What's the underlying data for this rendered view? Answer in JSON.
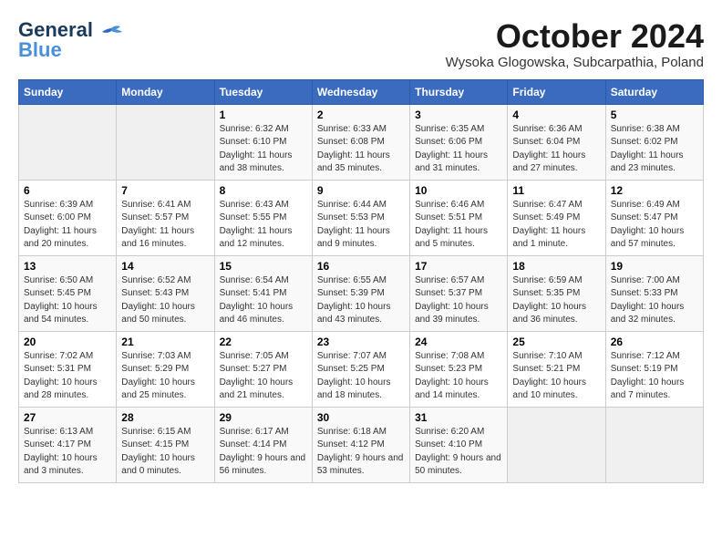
{
  "header": {
    "logo_line1": "General",
    "logo_line2": "Blue",
    "month": "October 2024",
    "location": "Wysoka Glogowska, Subcarpathia, Poland"
  },
  "days_of_week": [
    "Sunday",
    "Monday",
    "Tuesday",
    "Wednesday",
    "Thursday",
    "Friday",
    "Saturday"
  ],
  "weeks": [
    [
      {
        "day": "",
        "sunrise": "",
        "sunset": "",
        "daylight": ""
      },
      {
        "day": "",
        "sunrise": "",
        "sunset": "",
        "daylight": ""
      },
      {
        "day": "1",
        "sunrise": "Sunrise: 6:32 AM",
        "sunset": "Sunset: 6:10 PM",
        "daylight": "Daylight: 11 hours and 38 minutes."
      },
      {
        "day": "2",
        "sunrise": "Sunrise: 6:33 AM",
        "sunset": "Sunset: 6:08 PM",
        "daylight": "Daylight: 11 hours and 35 minutes."
      },
      {
        "day": "3",
        "sunrise": "Sunrise: 6:35 AM",
        "sunset": "Sunset: 6:06 PM",
        "daylight": "Daylight: 11 hours and 31 minutes."
      },
      {
        "day": "4",
        "sunrise": "Sunrise: 6:36 AM",
        "sunset": "Sunset: 6:04 PM",
        "daylight": "Daylight: 11 hours and 27 minutes."
      },
      {
        "day": "5",
        "sunrise": "Sunrise: 6:38 AM",
        "sunset": "Sunset: 6:02 PM",
        "daylight": "Daylight: 11 hours and 23 minutes."
      }
    ],
    [
      {
        "day": "6",
        "sunrise": "Sunrise: 6:39 AM",
        "sunset": "Sunset: 6:00 PM",
        "daylight": "Daylight: 11 hours and 20 minutes."
      },
      {
        "day": "7",
        "sunrise": "Sunrise: 6:41 AM",
        "sunset": "Sunset: 5:57 PM",
        "daylight": "Daylight: 11 hours and 16 minutes."
      },
      {
        "day": "8",
        "sunrise": "Sunrise: 6:43 AM",
        "sunset": "Sunset: 5:55 PM",
        "daylight": "Daylight: 11 hours and 12 minutes."
      },
      {
        "day": "9",
        "sunrise": "Sunrise: 6:44 AM",
        "sunset": "Sunset: 5:53 PM",
        "daylight": "Daylight: 11 hours and 9 minutes."
      },
      {
        "day": "10",
        "sunrise": "Sunrise: 6:46 AM",
        "sunset": "Sunset: 5:51 PM",
        "daylight": "Daylight: 11 hours and 5 minutes."
      },
      {
        "day": "11",
        "sunrise": "Sunrise: 6:47 AM",
        "sunset": "Sunset: 5:49 PM",
        "daylight": "Daylight: 11 hours and 1 minute."
      },
      {
        "day": "12",
        "sunrise": "Sunrise: 6:49 AM",
        "sunset": "Sunset: 5:47 PM",
        "daylight": "Daylight: 10 hours and 57 minutes."
      }
    ],
    [
      {
        "day": "13",
        "sunrise": "Sunrise: 6:50 AM",
        "sunset": "Sunset: 5:45 PM",
        "daylight": "Daylight: 10 hours and 54 minutes."
      },
      {
        "day": "14",
        "sunrise": "Sunrise: 6:52 AM",
        "sunset": "Sunset: 5:43 PM",
        "daylight": "Daylight: 10 hours and 50 minutes."
      },
      {
        "day": "15",
        "sunrise": "Sunrise: 6:54 AM",
        "sunset": "Sunset: 5:41 PM",
        "daylight": "Daylight: 10 hours and 46 minutes."
      },
      {
        "day": "16",
        "sunrise": "Sunrise: 6:55 AM",
        "sunset": "Sunset: 5:39 PM",
        "daylight": "Daylight: 10 hours and 43 minutes."
      },
      {
        "day": "17",
        "sunrise": "Sunrise: 6:57 AM",
        "sunset": "Sunset: 5:37 PM",
        "daylight": "Daylight: 10 hours and 39 minutes."
      },
      {
        "day": "18",
        "sunrise": "Sunrise: 6:59 AM",
        "sunset": "Sunset: 5:35 PM",
        "daylight": "Daylight: 10 hours and 36 minutes."
      },
      {
        "day": "19",
        "sunrise": "Sunrise: 7:00 AM",
        "sunset": "Sunset: 5:33 PM",
        "daylight": "Daylight: 10 hours and 32 minutes."
      }
    ],
    [
      {
        "day": "20",
        "sunrise": "Sunrise: 7:02 AM",
        "sunset": "Sunset: 5:31 PM",
        "daylight": "Daylight: 10 hours and 28 minutes."
      },
      {
        "day": "21",
        "sunrise": "Sunrise: 7:03 AM",
        "sunset": "Sunset: 5:29 PM",
        "daylight": "Daylight: 10 hours and 25 minutes."
      },
      {
        "day": "22",
        "sunrise": "Sunrise: 7:05 AM",
        "sunset": "Sunset: 5:27 PM",
        "daylight": "Daylight: 10 hours and 21 minutes."
      },
      {
        "day": "23",
        "sunrise": "Sunrise: 7:07 AM",
        "sunset": "Sunset: 5:25 PM",
        "daylight": "Daylight: 10 hours and 18 minutes."
      },
      {
        "day": "24",
        "sunrise": "Sunrise: 7:08 AM",
        "sunset": "Sunset: 5:23 PM",
        "daylight": "Daylight: 10 hours and 14 minutes."
      },
      {
        "day": "25",
        "sunrise": "Sunrise: 7:10 AM",
        "sunset": "Sunset: 5:21 PM",
        "daylight": "Daylight: 10 hours and 10 minutes."
      },
      {
        "day": "26",
        "sunrise": "Sunrise: 7:12 AM",
        "sunset": "Sunset: 5:19 PM",
        "daylight": "Daylight: 10 hours and 7 minutes."
      }
    ],
    [
      {
        "day": "27",
        "sunrise": "Sunrise: 6:13 AM",
        "sunset": "Sunset: 4:17 PM",
        "daylight": "Daylight: 10 hours and 3 minutes."
      },
      {
        "day": "28",
        "sunrise": "Sunrise: 6:15 AM",
        "sunset": "Sunset: 4:15 PM",
        "daylight": "Daylight: 10 hours and 0 minutes."
      },
      {
        "day": "29",
        "sunrise": "Sunrise: 6:17 AM",
        "sunset": "Sunset: 4:14 PM",
        "daylight": "Daylight: 9 hours and 56 minutes."
      },
      {
        "day": "30",
        "sunrise": "Sunrise: 6:18 AM",
        "sunset": "Sunset: 4:12 PM",
        "daylight": "Daylight: 9 hours and 53 minutes."
      },
      {
        "day": "31",
        "sunrise": "Sunrise: 6:20 AM",
        "sunset": "Sunset: 4:10 PM",
        "daylight": "Daylight: 9 hours and 50 minutes."
      },
      {
        "day": "",
        "sunrise": "",
        "sunset": "",
        "daylight": ""
      },
      {
        "day": "",
        "sunrise": "",
        "sunset": "",
        "daylight": ""
      }
    ]
  ]
}
